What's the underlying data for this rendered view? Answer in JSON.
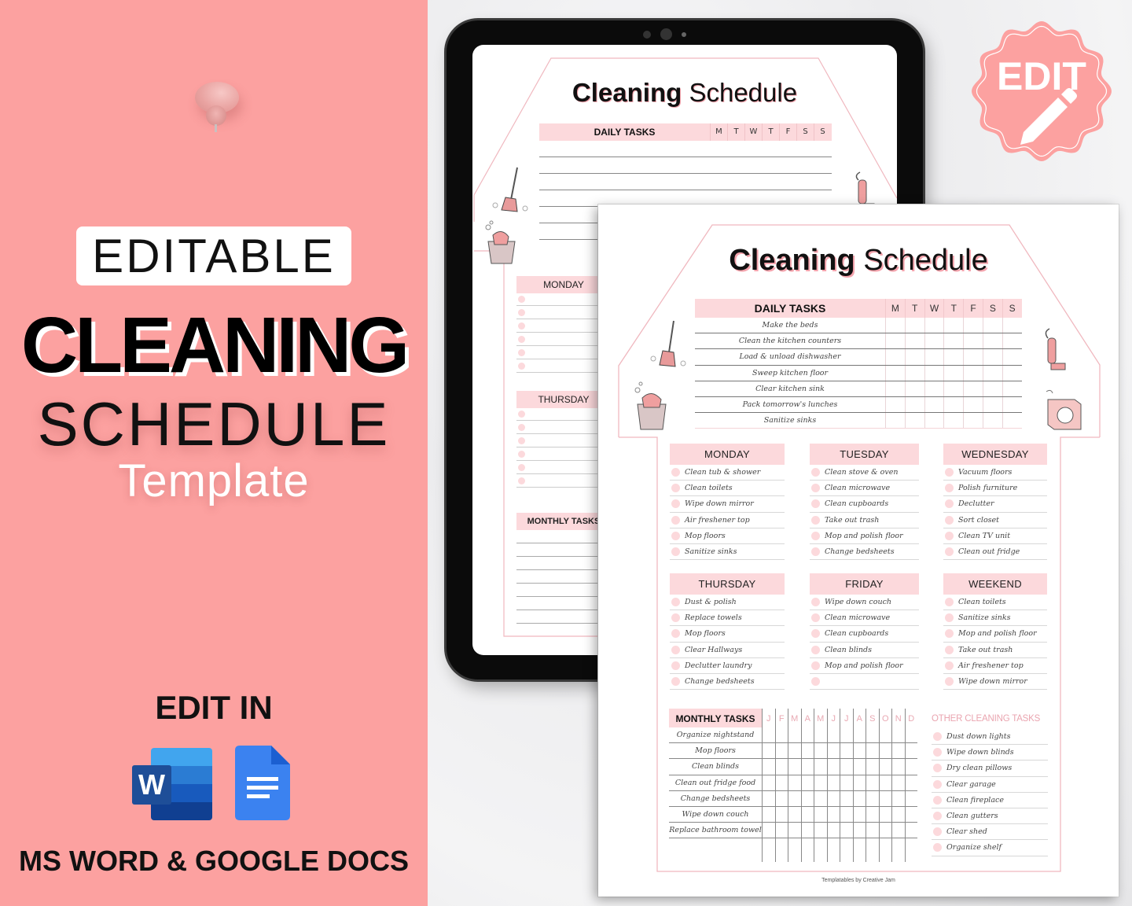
{
  "left_panel": {
    "badge_label": "EDITABLE",
    "title_line1": "CLEANING",
    "title_line2": "SCHEDULE",
    "title_line3": "Template",
    "edit_in_label": "EDIT IN",
    "word_icon_letter": "W",
    "apps_label": "MS WORD & GOOGLE DOCS",
    "icons": [
      "pushpin-icon",
      "ms-word-icon",
      "google-docs-icon"
    ],
    "colors": {
      "background": "#fca1a0",
      "word_blue": "#1e4e98",
      "docs_blue": "#3b82f0"
    }
  },
  "edit_badge": {
    "label": "EDIT",
    "icon": "pencil-icon",
    "color": "#fca1a0"
  },
  "tablet_preview": {
    "title_bold": "Cleaning",
    "title_light": "Schedule",
    "daily_header": "DAILY TASKS",
    "days_short": [
      "M",
      "T",
      "W",
      "T",
      "F",
      "S",
      "S"
    ],
    "day_sections": [
      "MONDAY",
      "THURSDAY"
    ],
    "monthly_header": "MONTHLY TASKS"
  },
  "document": {
    "title_bold": "Cleaning",
    "title_light": "Schedule",
    "daily": {
      "header": "DAILY TASKS",
      "days_short": [
        "M",
        "T",
        "W",
        "T",
        "F",
        "S",
        "S"
      ],
      "tasks": [
        "Make the beds",
        "Clean the kitchen counters",
        "Load & unload dishwasher",
        "Sweep kitchen floor",
        "Clear kitchen sink",
        "Pack tomorrow's lunches",
        "Sanitize sinks"
      ]
    },
    "weekdays": [
      {
        "name": "MONDAY",
        "tasks": [
          "Clean tub & shower",
          "Clean toilets",
          "Wipe down mirror",
          "Air freshener top",
          "Mop floors",
          "Sanitize sinks"
        ]
      },
      {
        "name": "TUESDAY",
        "tasks": [
          "Clean stove & oven",
          "Clean microwave",
          "Clean cupboards",
          "Take out trash",
          "Mop and polish floor",
          "Change bedsheets"
        ]
      },
      {
        "name": "WEDNESDAY",
        "tasks": [
          "Vacuum floors",
          "Polish furniture",
          "Declutter",
          "Sort closet",
          "Clean TV unit",
          "Clean out fridge"
        ]
      },
      {
        "name": "THURSDAY",
        "tasks": [
          "Dust & polish",
          "Replace towels",
          "Mop floors",
          "Clear Hallways",
          "Declutter laundry",
          "Change bedsheets"
        ]
      },
      {
        "name": "FRIDAY",
        "tasks": [
          "Wipe down couch",
          "Clean microwave",
          "Clean cupboards",
          "Clean blinds",
          "Mop and polish floor",
          ""
        ]
      },
      {
        "name": "WEEKEND",
        "tasks": [
          "Clean toilets",
          "Sanitize sinks",
          "Mop and polish floor",
          "Take out trash",
          "Air freshener top",
          "Wipe down mirror"
        ]
      }
    ],
    "monthly": {
      "header": "MONTHLY TASKS",
      "months_short": [
        "J",
        "F",
        "M",
        "A",
        "M",
        "J",
        "J",
        "A",
        "S",
        "O",
        "N",
        "D"
      ],
      "tasks": [
        "Organize nightstand",
        "Mop floors",
        "Clean blinds",
        "Clean out fridge food",
        "Change bedsheets",
        "Wipe down couch",
        "Replace bathroom towel"
      ]
    },
    "other": {
      "header": "OTHER CLEANING TASKS",
      "tasks": [
        "Dust down lights",
        "Wipe down blinds",
        "Dry clean pillows",
        "Clear garage",
        "Clean fireplace",
        "Clean gutters",
        "Clear shed",
        "Organize shelf"
      ]
    },
    "footer": "Templatables by Creative Jam",
    "stickers": [
      "broom-icon",
      "cleaning-bucket-icon",
      "vacuum-icon",
      "washing-machine-icon"
    ],
    "colors": {
      "accent_pink": "#fcd9dc",
      "outline_pink": "#f0b8bf",
      "month_label": "#e9a9b3"
    }
  }
}
